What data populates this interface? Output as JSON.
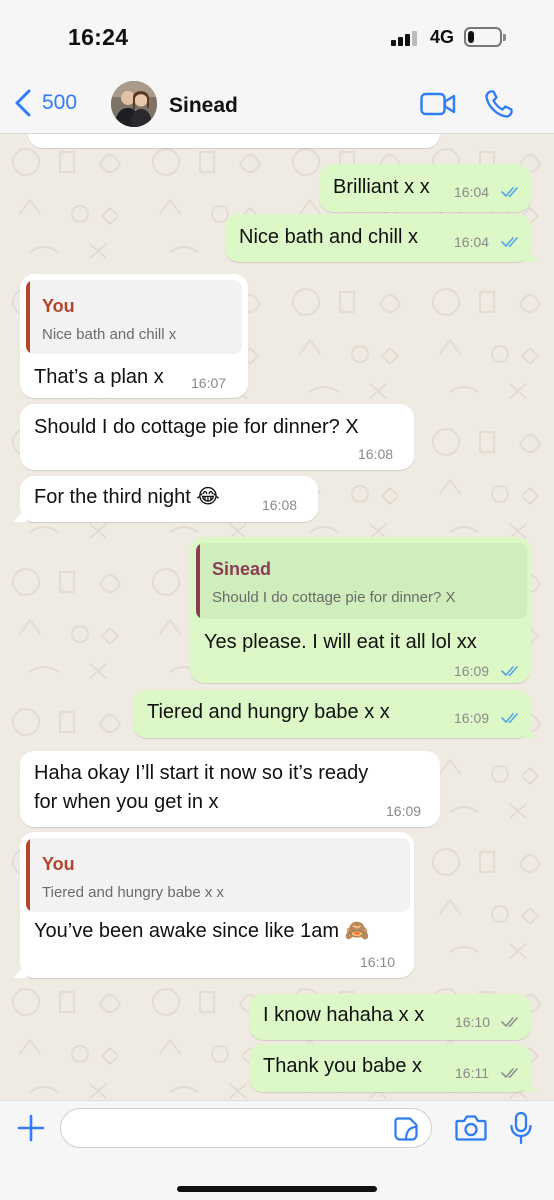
{
  "status_bar": {
    "time": "16:24",
    "network": "4G",
    "battery_level": 0.2
  },
  "header": {
    "back_count": "500",
    "contact_name": "Sinead",
    "accent_color": "#2f7cf6"
  },
  "messages": [
    {
      "dir": "out",
      "text": "Brilliant x x",
      "time": "16:04",
      "read": true
    },
    {
      "dir": "out",
      "text": "Nice bath and chill x",
      "time": "16:04",
      "read": true
    },
    {
      "dir": "in",
      "reply_to": {
        "name": "You",
        "text": "Nice bath and chill x"
      },
      "text": "That’s a plan x",
      "time": "16:07"
    },
    {
      "dir": "in",
      "text": "Should I do cottage pie for dinner? X",
      "time": "16:08"
    },
    {
      "dir": "in",
      "text": "For the third night 😂",
      "time": "16:08"
    },
    {
      "dir": "out",
      "reply_to": {
        "name": "Sinead",
        "text": "Should I do cottage pie for dinner? X"
      },
      "text": "Yes please. I will eat it all lol xx",
      "time": "16:09",
      "read": true
    },
    {
      "dir": "out",
      "text": "Tiered and hungry babe x x",
      "time": "16:09",
      "read": true
    },
    {
      "dir": "in",
      "text_lines": [
        "Haha okay I’ll start it now so it’s ready",
        "for when you get in x"
      ],
      "time": "16:09"
    },
    {
      "dir": "in",
      "reply_to": {
        "name": "You",
        "text": "Tiered and hungry babe x x"
      },
      "text": "You’ve been awake since like 1am 🙈",
      "time": "16:10"
    },
    {
      "dir": "out",
      "text": "I know hahaha x x",
      "time": "16:10",
      "read": false
    },
    {
      "dir": "out",
      "text": "Thank you babe x",
      "time": "16:11",
      "read": false
    }
  ],
  "colors": {
    "outgoing_bubble": "#dcf8c6",
    "incoming_bubble": "#ffffff",
    "chat_background": "#efeae2",
    "read_ticks": "#53a6e6",
    "delivered_ticks": "#8f8f8f",
    "reply_name_you": "#b5452a",
    "reply_name_contact": "#8a3d55"
  },
  "input": {
    "placeholder": ""
  },
  "icons": [
    "back-chevron-icon",
    "video-call-icon",
    "phone-icon",
    "plus-icon",
    "sticker-icon",
    "camera-icon",
    "microphone-icon"
  ]
}
